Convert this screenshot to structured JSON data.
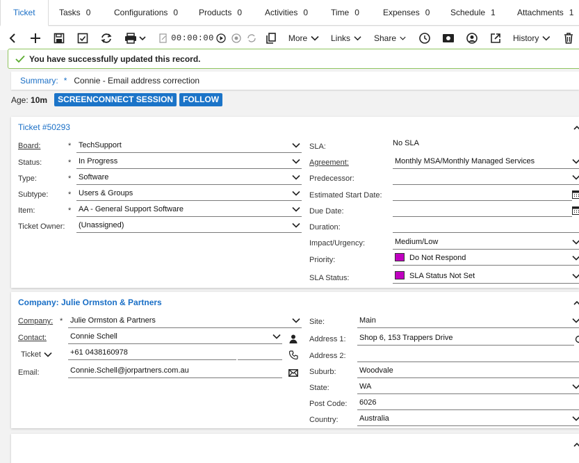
{
  "tabs": [
    {
      "label": "Ticket",
      "count": ""
    },
    {
      "label": "Tasks",
      "count": "0"
    },
    {
      "label": "Configurations",
      "count": "0"
    },
    {
      "label": "Products",
      "count": "0"
    },
    {
      "label": "Activities",
      "count": "0"
    },
    {
      "label": "Time",
      "count": "0"
    },
    {
      "label": "Expenses",
      "count": "0"
    },
    {
      "label": "Schedule",
      "count": "1"
    },
    {
      "label": "Attachments",
      "count": "1"
    }
  ],
  "toolbar": {
    "timer": "00:00:00",
    "more_label": "More",
    "links_label": "Links",
    "share_label": "Share",
    "history_label": "History"
  },
  "success_message": "You have successfully updated this record.",
  "summary": {
    "label": "Summary:",
    "required": "*",
    "value": "Connie - Email address correction"
  },
  "age": {
    "label": "Age:",
    "value": "10m"
  },
  "actions": {
    "screenconnect": "SCREENCONNECT SESSION",
    "follow": "FOLLOW"
  },
  "ticket_panel": {
    "title": "Ticket #50293",
    "left_fields": [
      {
        "label": "Board:",
        "required": "*",
        "value": "TechSupport"
      },
      {
        "label": "Status:",
        "required": "*",
        "value": "In Progress"
      },
      {
        "label": "Type:",
        "required": "*",
        "value": "Software"
      },
      {
        "label": "Subtype:",
        "required": "*",
        "value": "Users & Groups"
      },
      {
        "label": "Item:",
        "required": "*",
        "value": "AA - General Support Software"
      },
      {
        "label": "Ticket Owner:",
        "required": "",
        "value": "(Unassigned)"
      }
    ],
    "right_fields": [
      {
        "label": "SLA:",
        "value": "No SLA"
      },
      {
        "label": "Agreement:",
        "value": "Monthly MSA/Monthly Managed Services"
      },
      {
        "label": "Predecessor:",
        "value": ""
      },
      {
        "label": "Estimated Start Date:",
        "value": ""
      },
      {
        "label": "Due Date:",
        "value": ""
      },
      {
        "label": "Duration:",
        "value": ""
      },
      {
        "label": "Impact/Urgency:",
        "value": "Medium/Low"
      },
      {
        "label": "Priority:",
        "value": "Do Not Respond",
        "color": "#c000c0"
      },
      {
        "label": "SLA Status:",
        "value": "SLA Status Not Set",
        "color": "#c000c0"
      }
    ]
  },
  "company_panel": {
    "title": "Company: Julie Ormston & Partners",
    "company": {
      "label": "Company:",
      "required": "*",
      "value": "Julie Ormston & Partners"
    },
    "contact": {
      "label": "Contact:",
      "value": "Connie Schell"
    },
    "phone_type": {
      "label": "Ticket",
      "value": "+61 0438160978"
    },
    "email": {
      "label": "Email:",
      "value": "Connie.Schell@jorpartners.com.au"
    },
    "site": {
      "label": "Site:",
      "value": "Main"
    },
    "address1": {
      "label": "Address 1:",
      "value": "Shop 6, 153 Trappers Drive"
    },
    "address2": {
      "label": "Address 2:",
      "value": ""
    },
    "suburb": {
      "label": "Suburb:",
      "value": "Woodvale"
    },
    "state": {
      "label": "State:",
      "value": "WA"
    },
    "postcode": {
      "label": "Post Code:",
      "value": "6026"
    },
    "country": {
      "label": "Country:",
      "value": "Australia"
    }
  },
  "colors": {
    "accent": "#1a6fc6",
    "button": "#1b74c8",
    "success_border": "#8fc45e",
    "priority": "#c000c0"
  }
}
